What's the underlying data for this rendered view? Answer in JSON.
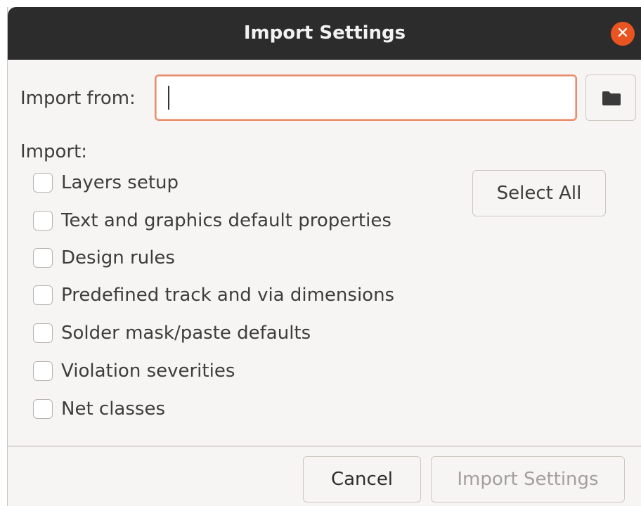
{
  "dialog": {
    "title": "Import Settings",
    "close_icon": "close-icon"
  },
  "import_from": {
    "label": "Import from:",
    "value": "",
    "browse_icon": "folder-icon"
  },
  "import_section": {
    "label": "Import:",
    "options": [
      {
        "label": "Layers setup",
        "checked": false
      },
      {
        "label": "Text and graphics default properties",
        "checked": false
      },
      {
        "label": "Design rules",
        "checked": false
      },
      {
        "label": "Predefined track and via dimensions",
        "checked": false
      },
      {
        "label": "Solder mask/paste defaults",
        "checked": false
      },
      {
        "label": "Violation severities",
        "checked": false
      },
      {
        "label": "Net classes",
        "checked": false
      }
    ],
    "select_all_label": "Select All"
  },
  "footer": {
    "cancel_label": "Cancel",
    "import_label": "Import Settings",
    "import_enabled": false
  },
  "colors": {
    "titlebar": "#2c2c2c",
    "accent": "#e95420",
    "focus_border": "#e98c6c",
    "disabled_text": "#a3a09c"
  }
}
